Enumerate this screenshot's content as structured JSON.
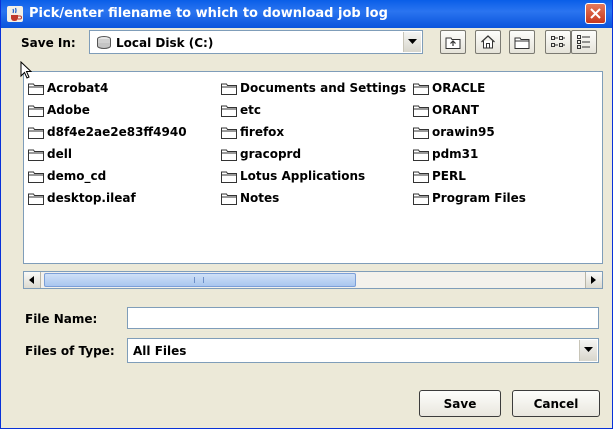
{
  "window": {
    "title": "Pick/enter filename to which to download job log"
  },
  "save_in": {
    "label": "Save In:",
    "value": "Local Disk (C:)"
  },
  "toolbar": {
    "buttons": [
      "up-one-level-icon",
      "home-icon",
      "new-folder-icon",
      "list-view-icon",
      "details-view-icon"
    ]
  },
  "files": [
    "Acrobat4",
    "Adobe",
    "d8f4e2ae2e83ff4940",
    "dell",
    "demo_cd",
    "desktop.ileaf",
    "Documents and Settings",
    "etc",
    "firefox",
    "gracoprd",
    "Lotus Applications",
    "Notes",
    "ORACLE",
    "ORANT",
    "orawin95",
    "pdm31",
    "PERL",
    "Program Files"
  ],
  "file_name": {
    "label": "File Name:",
    "value": ""
  },
  "file_type": {
    "label": "Files of Type:",
    "value": "All Files"
  },
  "actions": {
    "save_label": "Save",
    "cancel_label": "Cancel"
  },
  "colors": {
    "titlebar": "#0a5ee8",
    "dialog_bg": "#ece9d8",
    "border": "#7f9db9"
  }
}
